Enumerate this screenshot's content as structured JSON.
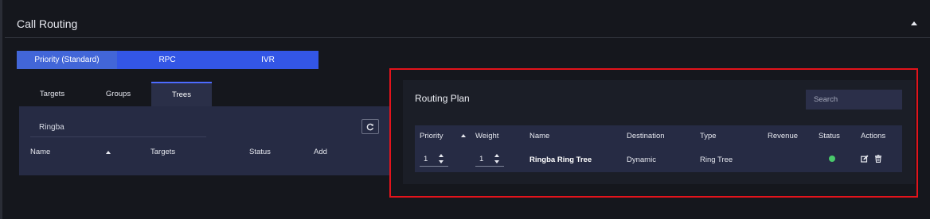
{
  "section": {
    "title": "Call Routing"
  },
  "mode_tabs": [
    {
      "label": "Priority (Standard)",
      "active": true
    },
    {
      "label": "RPC",
      "active": false
    },
    {
      "label": "IVR",
      "active": false
    }
  ],
  "sub_tabs": [
    {
      "label": "Targets",
      "active": false
    },
    {
      "label": "Groups",
      "active": false
    },
    {
      "label": "Trees",
      "active": true
    }
  ],
  "trees": {
    "filter_value": "Ringba",
    "columns": [
      "Name",
      "Targets",
      "Status",
      "Add"
    ]
  },
  "routing_plan": {
    "title": "Routing Plan",
    "search_placeholder": "Search",
    "columns": [
      "Priority",
      "Weight",
      "Name",
      "Destination",
      "Type",
      "Revenue",
      "Status",
      "Actions"
    ],
    "rows": [
      {
        "priority": "1",
        "weight": "1",
        "name": "Ringba Ring Tree",
        "destination": "Dynamic",
        "type": "Ring Tree",
        "revenue": "",
        "status": "active"
      }
    ]
  },
  "colors": {
    "accent": "#3356e6",
    "highlight_box": "#e3131b",
    "status_active": "#49c96b",
    "panel": "#262b44"
  },
  "icons": [
    "collapse-up-icon",
    "sort-up-icon",
    "refresh-icon",
    "edit-icon",
    "trash-icon"
  ]
}
